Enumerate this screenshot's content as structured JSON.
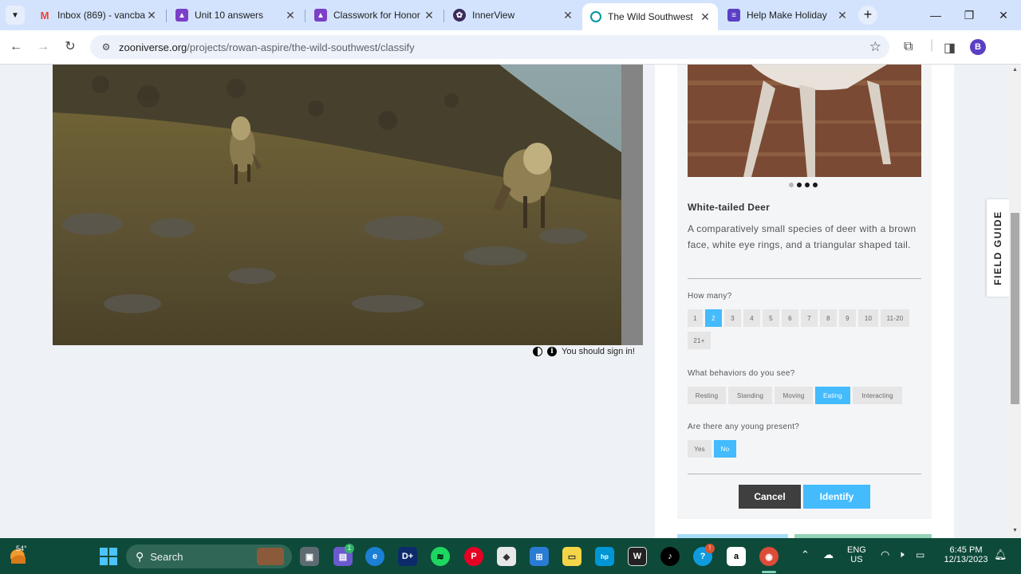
{
  "browser": {
    "tabs": [
      {
        "title": "Inbox (869) - vancba",
        "favicon": "gmail-icon",
        "color": "#ea4335",
        "active": false
      },
      {
        "title": "Unit 10 answers",
        "favicon": "classroom-icon",
        "color": "#7b3fc8",
        "active": false
      },
      {
        "title": "Classwork for Honor",
        "favicon": "classroom-icon",
        "color": "#7b3fc8",
        "active": false
      },
      {
        "title": "InnerView",
        "favicon": "innerview-icon",
        "color": "#3b2a5c",
        "active": false
      },
      {
        "title": "The Wild Southwest",
        "favicon": "zooniverse-icon",
        "color": "#00979d",
        "active": true
      },
      {
        "title": "Help Make Holiday",
        "favicon": "forms-icon",
        "color": "#5b3fc4",
        "active": false
      }
    ],
    "address": {
      "host": "zooniverse.org",
      "path": "/projects/rowan-aspire/the-wild-southwest/classify"
    },
    "profile_initial": "B"
  },
  "subject": {
    "sign_in_text": "You should sign in!"
  },
  "field_guide_card": {
    "species": "White-tailed Deer",
    "description": "A comparatively small species of deer with a brown face, white eye rings, and a triangular shaped tail.",
    "image_dots": 4,
    "active_dot": 1
  },
  "questions": {
    "how_many": {
      "prompt": "How many?",
      "options": [
        "1",
        "2",
        "3",
        "4",
        "5",
        "6",
        "7",
        "8",
        "9",
        "10",
        "11-20",
        "21+"
      ],
      "selected": "2"
    },
    "behaviors": {
      "prompt": "What behaviors do you see?",
      "options": [
        "Resting",
        "Standing",
        "Moving",
        "Eating",
        "Interacting"
      ],
      "selected": "Eating"
    },
    "young": {
      "prompt": "Are there any young present?",
      "options": [
        "Yes",
        "No"
      ],
      "selected": "No"
    }
  },
  "actions": {
    "cancel": "Cancel",
    "identify": "Identify"
  },
  "field_guide_tab": "FIELD GUIDE",
  "taskbar": {
    "weather_temp": "54°",
    "search_label": "Search",
    "teams_badge": "1",
    "language": "ENG",
    "region": "US",
    "time": "6:45 PM",
    "date": "12/13/2023"
  },
  "colors": {
    "accent": "#43bbfd",
    "taskbar": "#0e4a3a"
  }
}
